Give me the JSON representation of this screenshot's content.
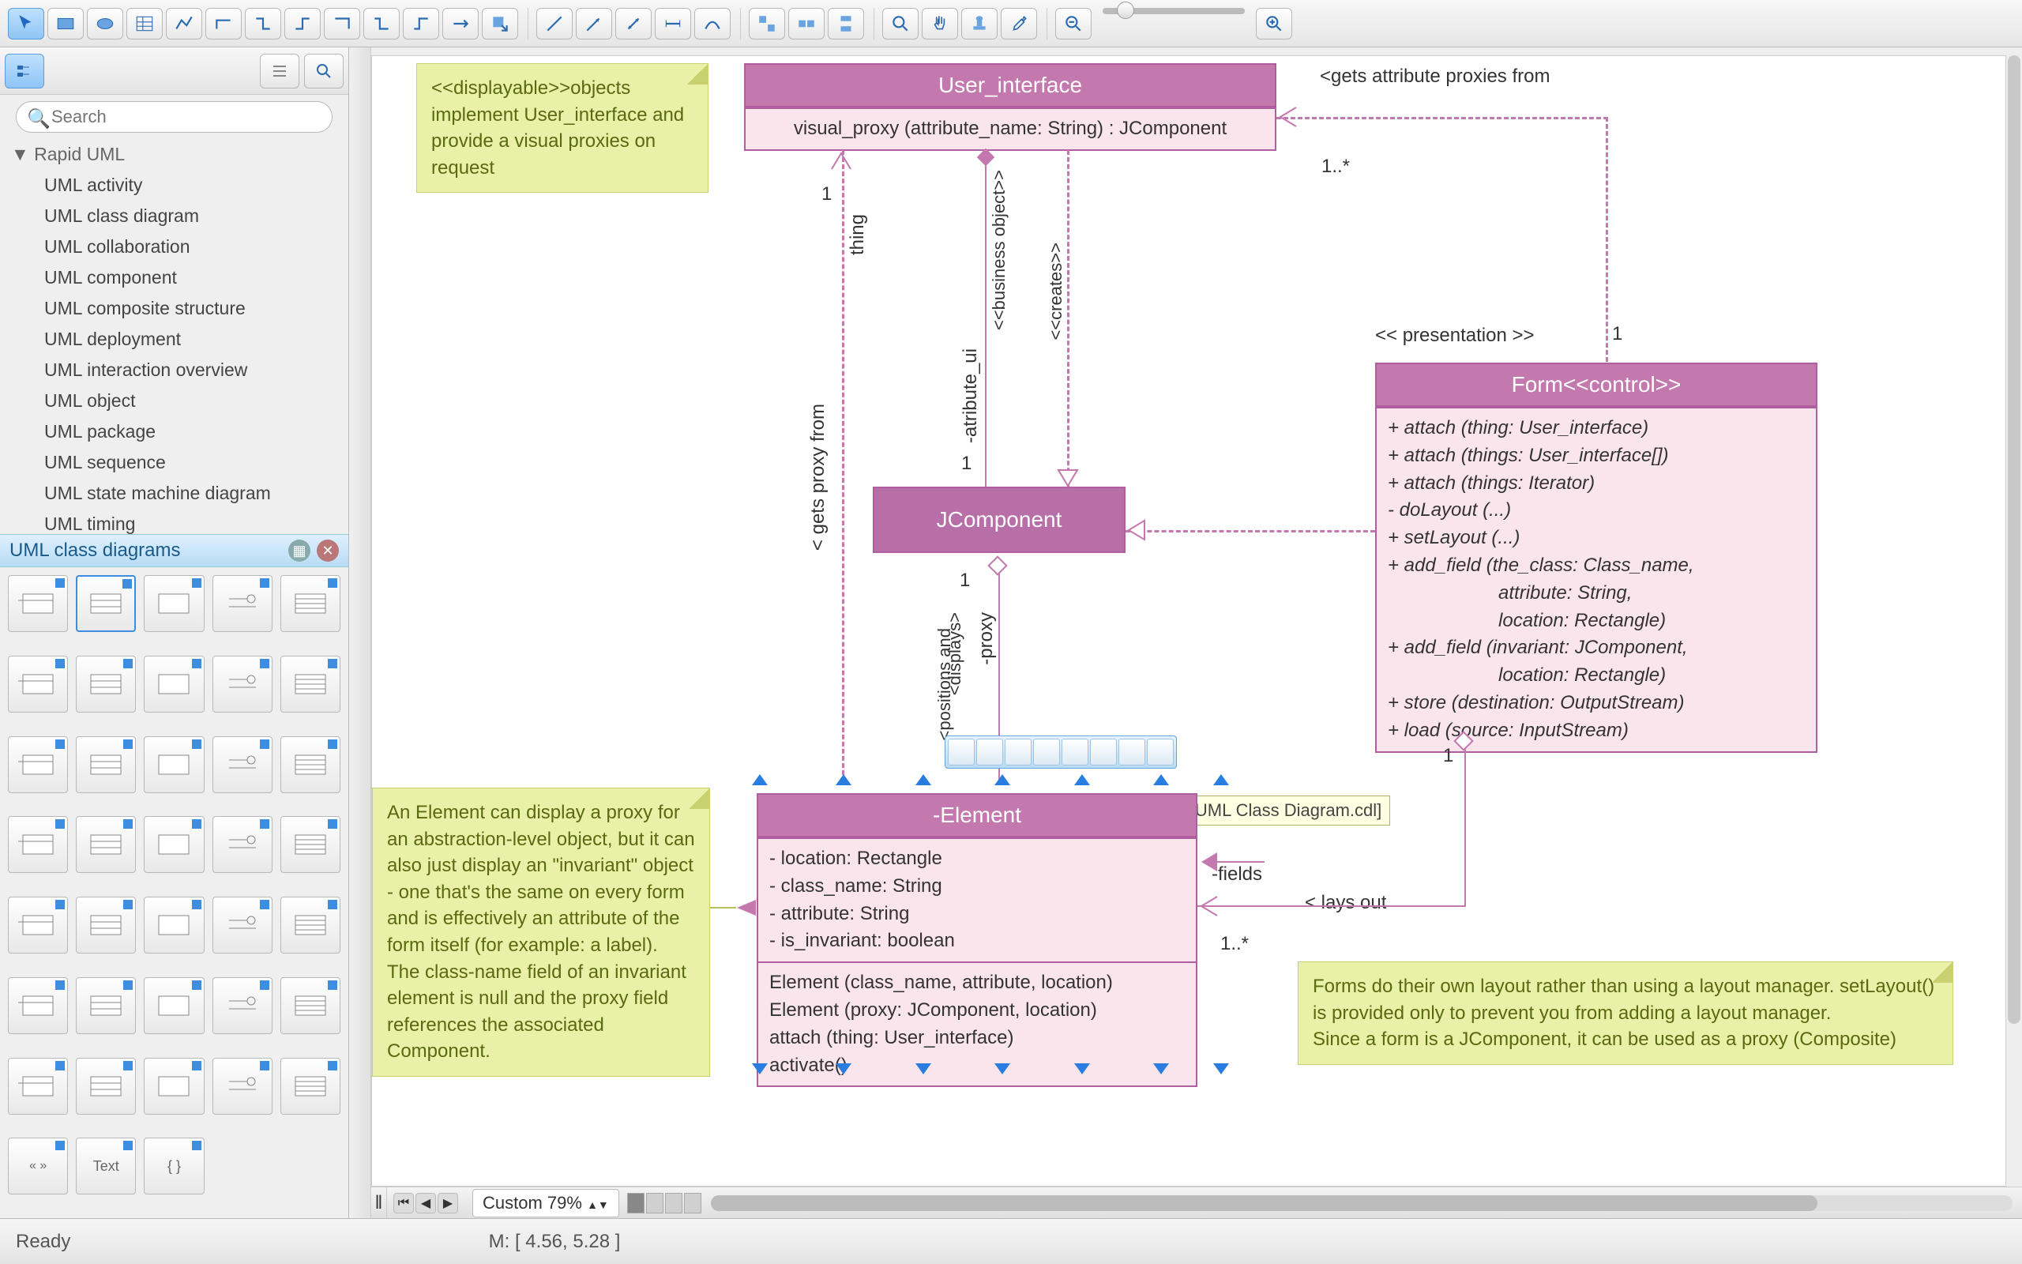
{
  "toolbar": {
    "groups": [
      [
        "pointer",
        "rectangle",
        "ellipse",
        "table",
        "polyline",
        "bezier",
        "angle-connector",
        "connector-1",
        "connector-2",
        "connector-3",
        "connector-4",
        "connector-5",
        "export"
      ],
      [
        "line",
        "arrow",
        "double-arrow",
        "dimension",
        "curved"
      ],
      [
        "group-1",
        "group-2",
        "group-3"
      ],
      [
        "zoom-in-tool",
        "pan-tool",
        "stamp",
        "eyedropper"
      ]
    ],
    "zoom": {
      "out": "zoom-out",
      "in": "zoom-in"
    }
  },
  "sidebar": {
    "search_placeholder": "Search",
    "tree_header": "Rapid UML",
    "tree_items": [
      "UML activity",
      "UML class diagram",
      "UML collaboration",
      "UML component",
      "UML composite structure",
      "UML deployment",
      "UML interaction overview",
      "UML object",
      "UML package",
      "UML sequence",
      "UML state machine diagram",
      "UML timing"
    ],
    "palette_title": "UML class diagrams",
    "palette_count": 38
  },
  "canvas": {
    "user_interface": {
      "title": "User_interface",
      "op": "visual_proxy (attribute_name: String) : JComponent"
    },
    "jcomponent": "JComponent",
    "form": {
      "title": "Form<<control>>",
      "rows": [
        "+ attach (thing: User_interface)",
        "+ attach (things: User_interface[])",
        "+ attach (things: Iterator)",
        "- doLayout (...)",
        "+ setLayout (...)",
        "+ add_field (the_class: Class_name,",
        "                     attribute: String,",
        "                     location: Rectangle)",
        "+ add_field (invariant: JComponent,",
        "                     location: Rectangle)",
        "+ store (destination: OutputStream)",
        "+ load (source: InputStream)"
      ]
    },
    "element": {
      "title": "-Element",
      "attrs": [
        "- location: Rectangle",
        "- class_name: String",
        "- attribute: String",
        "- is_invariant: boolean"
      ],
      "ops": [
        "Element (class_name, attribute, location)",
        "Element (proxy: JComponent, location)",
        "attach (thing: User_interface)",
        "activate()"
      ]
    },
    "note_displayable": "<<displayable>>objects implement User_interface and provide a visual proxies on request",
    "note_element": "An Element can display a proxy for an abstraction-level object, but it can also just display an \"invariant\" object - one that's the same on every form and is effectively an attribute of the form itself (for example: a label). The class-name field of an invariant element is null and the proxy field references the associated Component.",
    "note_form": "Forms do their own layout rather than using a layout manager. setLayout() is provided only to prevent you from adding a layout manager.\nSince a form is a JComponent, it can be used as a proxy (Composite)",
    "labels": {
      "gets_attr": "<gets attribute proxies from",
      "one_star_1": "1..*",
      "presentation": "<< presentation >>",
      "one_p": "1",
      "gets_proxy": "< gets proxy from",
      "thing": "thing",
      "one_t1": "1",
      "one_t2": "1",
      "attr_ui": "-atribute_ui",
      "business": "<<business object>>",
      "creates": "<<creates>>",
      "displays": "<displays>",
      "proxy": "-proxy",
      "positions": "<positions and",
      "one_j": "1",
      "fields": "-fields",
      "lays_out": "< lays out",
      "one_star_2": "1..*",
      "one_f": "1"
    },
    "tooltip": "Association One-to-One[UML Class Diagram.cdl]"
  },
  "footer": {
    "zoom": "Custom 79%",
    "ready": "Ready",
    "mouse": "M: [ 4.56, 5.28 ]"
  }
}
